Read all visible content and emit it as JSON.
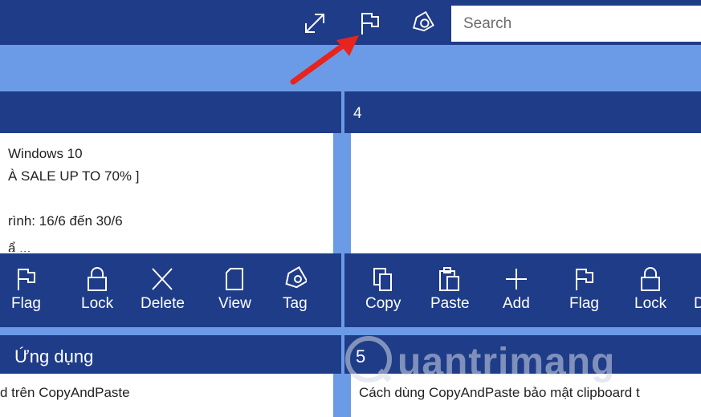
{
  "topbar": {
    "expand_icon": "expand-icon",
    "flag_icon": "flag-icon",
    "tag_icon": "tag-icon",
    "search_placeholder": "Search"
  },
  "left": {
    "header_label": "",
    "lines": [
      "Windows 10",
      "À SALE UP TO 70% ]",
      "",
      "rình: 16/6 đến 30/6",
      "ẩ ..."
    ],
    "actions": [
      {
        "label": "Flag",
        "icon": "flag-icon"
      },
      {
        "label": "Lock",
        "icon": "lock-icon"
      },
      {
        "label": "Delete",
        "icon": "delete-icon"
      },
      {
        "label": "View",
        "icon": "view-icon"
      },
      {
        "label": "Tag",
        "icon": "tag-icon"
      }
    ],
    "bottom_header": "Ứng dụng",
    "bottom_snippet": "d trên CopyAndPaste"
  },
  "right": {
    "header_label": "4",
    "lines": [],
    "actions": [
      {
        "label": "Copy",
        "icon": "copy-icon"
      },
      {
        "label": "Paste",
        "icon": "paste-icon"
      },
      {
        "label": "Add",
        "icon": "add-icon"
      },
      {
        "label": "Flag",
        "icon": "flag-icon"
      },
      {
        "label": "Lock",
        "icon": "lock-icon"
      },
      {
        "label": "D",
        "icon": ""
      }
    ],
    "bottom_header": "5",
    "bottom_snippet": "Cách dùng CopyAndPaste bảo  mật clipboard t"
  },
  "watermark": "uantrimang",
  "colors": {
    "dark_blue": "#1f3c88",
    "light_blue": "#6b9be6",
    "arrow_red": "#e8241e"
  }
}
